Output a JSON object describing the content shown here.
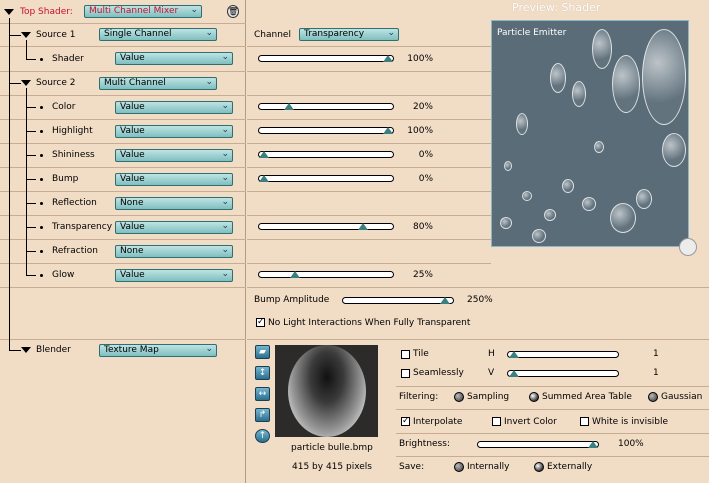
{
  "tree": {
    "top_shader": {
      "label": "Top Shader:",
      "value": "Multi Channel Mixer"
    },
    "source1": {
      "label": "Source 1",
      "value": "Single Channel"
    },
    "shader": {
      "label": "Shader",
      "value": "Value"
    },
    "source2": {
      "label": "Source 2",
      "value": "Multi Channel"
    },
    "channels": [
      {
        "label": "Color",
        "value": "Value"
      },
      {
        "label": "Highlight",
        "value": "Value"
      },
      {
        "label": "Shininess",
        "value": "Value"
      },
      {
        "label": "Bump",
        "value": "Value"
      },
      {
        "label": "Reflection",
        "value": "None"
      },
      {
        "label": "Transparency",
        "value": "Value"
      },
      {
        "label": "Refraction",
        "value": "None"
      },
      {
        "label": "Glow",
        "value": "Value"
      }
    ],
    "blender": {
      "label": "Blender",
      "value": "Texture Map"
    }
  },
  "channel_selector": {
    "label": "Channel",
    "value": "Transparency"
  },
  "slider_rows": [
    {
      "value": "100%",
      "pos": 1.0
    },
    {
      "value": "20%",
      "pos": 0.2
    },
    {
      "value": "100%",
      "pos": 1.0
    },
    {
      "value": "0%",
      "pos": 0.0
    },
    {
      "value": "0%",
      "pos": 0.0
    },
    {
      "value": "80%",
      "pos": 0.8
    },
    {
      "value": "25%",
      "pos": 0.25
    }
  ],
  "bump_amplitude": {
    "label": "Bump Amplitude",
    "value": "250%",
    "pos": 0.97
  },
  "no_light": {
    "label": "No Light Interactions When Fully Transparent",
    "checked": true
  },
  "preview": {
    "title": "Preview: Shader",
    "caption": "Particle Emitter"
  },
  "texture": {
    "filename": "particle bulle.bmp",
    "size": "415 by 415 pixels",
    "tile_label": "Tile",
    "seamlessly_label": "Seamlessly",
    "h_label": "H",
    "h_value": "1",
    "v_label": "V",
    "v_value": "1",
    "filtering_label": "Filtering:",
    "filter_options": [
      "Sampling",
      "Summed Area Table",
      "Gaussian"
    ],
    "filter_selected": 1,
    "interpolate_label": "Interpolate",
    "invert_label": "Invert Color",
    "white_label": "White is invisible",
    "brightness_label": "Brightness:",
    "brightness_value": "100%",
    "brightness_pos": 1.0,
    "save_label": "Save:",
    "save_options": [
      "Internally",
      "Externally"
    ],
    "save_selected": 1
  },
  "icons": [
    "trash-icon",
    "folder-open-icon",
    "flip-vertical-icon",
    "flip-horizontal-icon",
    "rotate-icon",
    "arrow-up-icon"
  ]
}
